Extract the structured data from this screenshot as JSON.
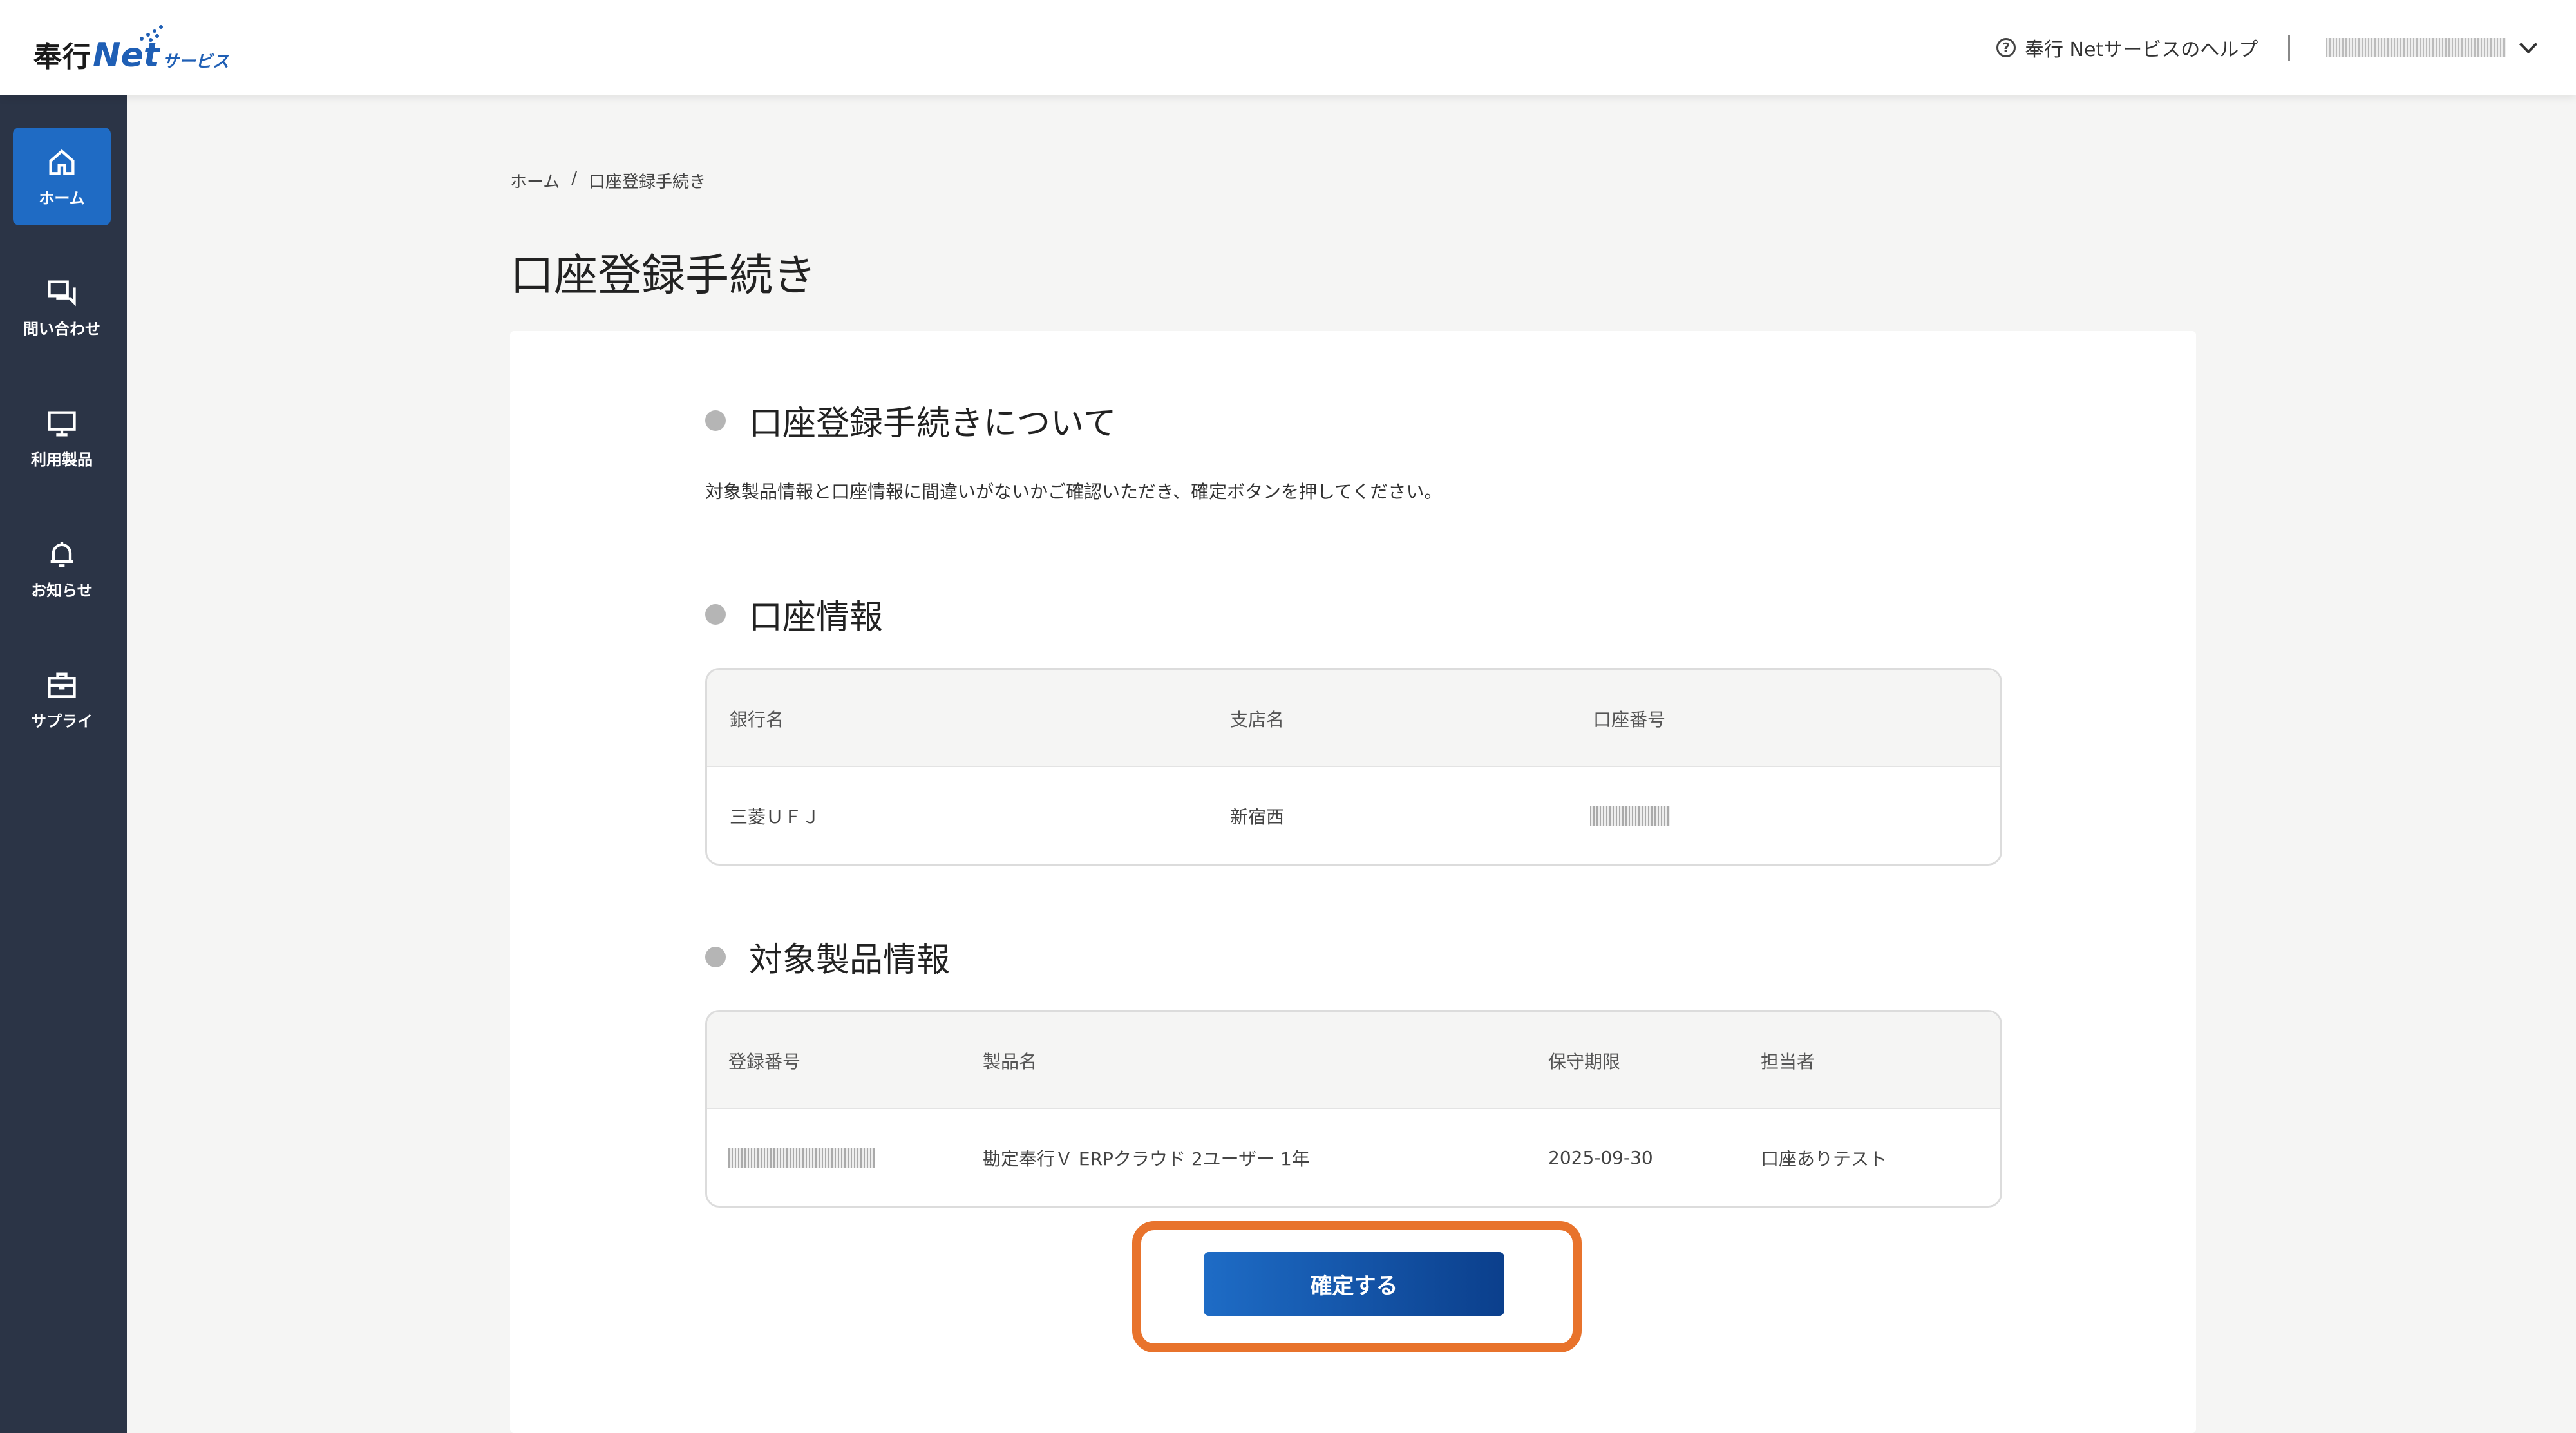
{
  "header": {
    "logo_main": "奉行",
    "logo_net": "Net",
    "logo_sub": "サービス",
    "help_label": "奉行 Netサービスのヘルプ"
  },
  "sidebar": {
    "items": [
      {
        "label": "ホーム",
        "icon": "home-icon",
        "active": true
      },
      {
        "label": "問い合わせ",
        "icon": "chat-icon",
        "active": false
      },
      {
        "label": "利用製品",
        "icon": "monitor-icon",
        "active": false
      },
      {
        "label": "お知らせ",
        "icon": "bell-icon",
        "active": false
      },
      {
        "label": "サプライ",
        "icon": "briefcase-icon",
        "active": false
      }
    ]
  },
  "breadcrumb": {
    "home": "ホーム",
    "separator": "/",
    "current": "口座登録手続き"
  },
  "page": {
    "title": "口座登録手続き"
  },
  "about": {
    "heading": "口座登録手続きについて",
    "description": "対象製品情報と口座情報に間違いがないかご確認いただき、確定ボタンを押してください。"
  },
  "account": {
    "heading": "口座情報",
    "columns": [
      "銀行名",
      "支店名",
      "口座番号"
    ],
    "row": {
      "bank": "三菱ＵＦＪ",
      "branch": "新宿西"
    }
  },
  "products": {
    "heading": "対象製品情報",
    "columns": [
      "登録番号",
      "製品名",
      "保守期限",
      "担当者"
    ],
    "row": {
      "product": "勘定奉行Ｖ ERPクラウド 2ユーザー 1年",
      "expiry": "2025-09-30",
      "person": "口座ありテスト"
    }
  },
  "confirm_label": "確定する",
  "colors": {
    "sidebar_bg": "#2b3446",
    "active_item": "#1f6bc4",
    "highlight": "#e8732c"
  }
}
